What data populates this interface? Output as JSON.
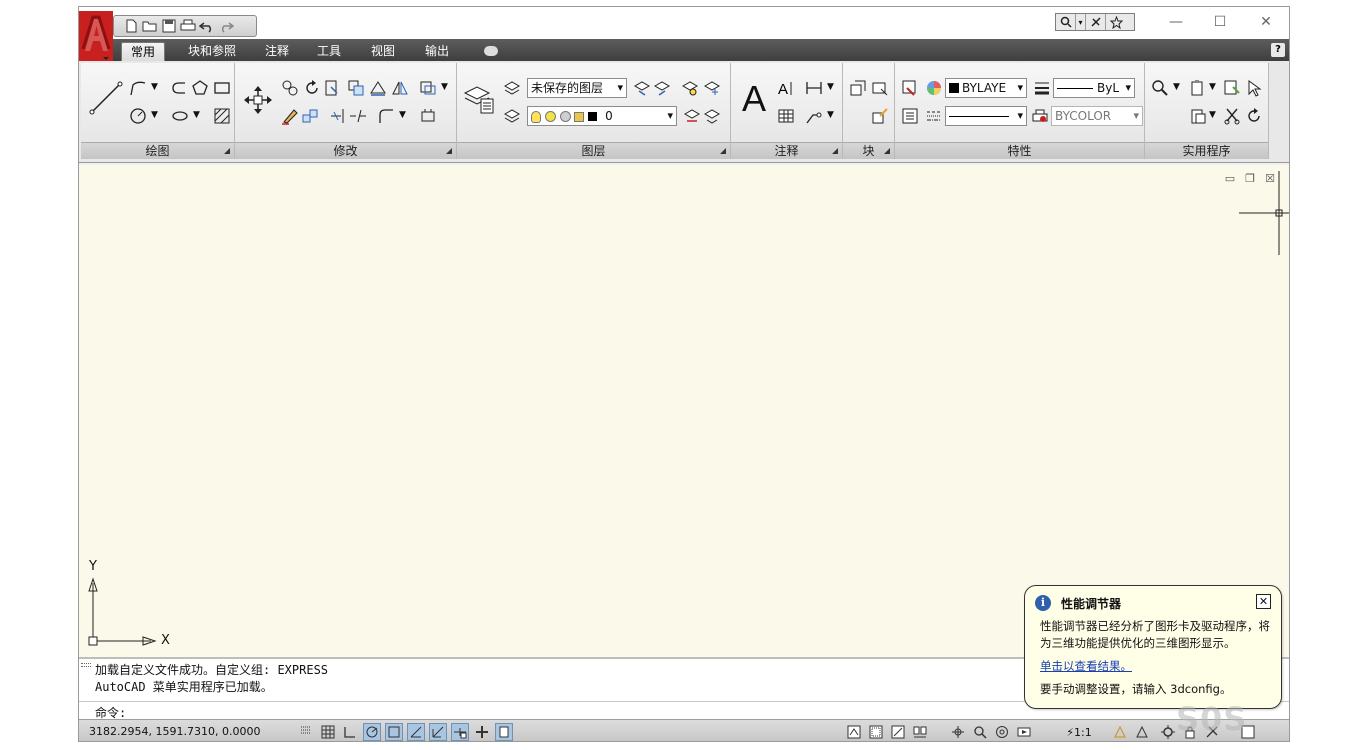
{
  "titlebar": {
    "quick_access": [
      "new-icon",
      "open-icon",
      "save-icon",
      "print-icon",
      "undo-icon",
      "redo-icon"
    ],
    "window_controls": {
      "minimize": "—",
      "maximize": "☐",
      "close": "✕"
    }
  },
  "tabs": [
    "常用",
    "块和参照",
    "注释",
    "工具",
    "视图",
    "输出"
  ],
  "help": "?",
  "panels": {
    "draw": "绘图",
    "modify": "修改",
    "layers": "图层",
    "annotation": "注释",
    "block": "块",
    "properties": "特性",
    "utilities": "实用程序"
  },
  "layers": {
    "layer_state": "未保存的图层",
    "current_layer": "0"
  },
  "properties": {
    "color": "BYLAYE",
    "linetype": "ByL",
    "plotstyle": "BYCOLOR"
  },
  "canvas": {
    "axis_x": "X",
    "axis_y": "Y",
    "background": "#fbf9ea"
  },
  "command": {
    "history": [
      "加载自定义文件成功。自定义组: EXPRESS",
      "AutoCAD 菜单实用程序已加载。"
    ],
    "prompt": "命令:"
  },
  "status": {
    "coordinates": "3182.2954, 1591.7310, 0.0000",
    "scale": "1:1"
  },
  "balloon": {
    "title": "性能调节器",
    "text": "性能调节器已经分析了图形卡及驱动程序，将为三维功能提供优化的三维图形显示。",
    "link": "单击以查看结果。",
    "hint": "要手动调整设置，请输入 3dconfig。"
  },
  "watermark": "S0S",
  "colors": {
    "accent_red": "#c8201e",
    "tab_bar": "#4a4a4a",
    "link": "#1a3fb0"
  }
}
